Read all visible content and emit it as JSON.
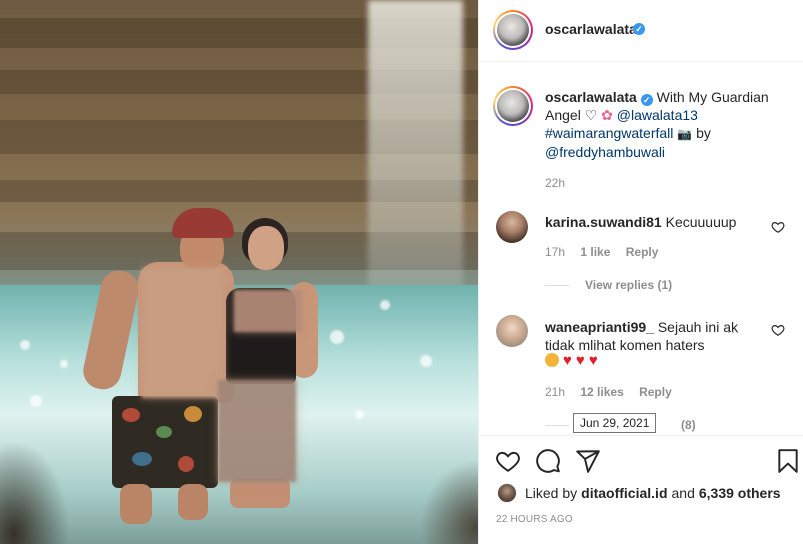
{
  "post": {
    "username": "oscarlawalata",
    "verified_mark": "✓"
  },
  "caption": {
    "username": "oscarlawalata",
    "text_1": "With My Guardian Angel",
    "mention_1": "@lawalata13",
    "hashtag": "#waimarangwaterfall",
    "by_text": "by",
    "mention_2": "@freddyhambuwali",
    "time": "22h"
  },
  "comments": [
    {
      "username": "karina.suwandi81",
      "text": "Kecuuuuup",
      "time": "17h",
      "likes": "1 like",
      "reply": "Reply",
      "view_replies": "View replies (1)"
    },
    {
      "username": "waneaprianti99_",
      "text": "Sejauh ini ak tidak mlihat komen haters",
      "more": "...",
      "time": "21h",
      "likes": "12 likes",
      "reply": "Reply",
      "view_replies_count": "(8)"
    }
  ],
  "tooltip": {
    "date": "Jun 29, 2021"
  },
  "likes": {
    "prefix": "Liked by",
    "user": "ditaofficial.id",
    "connector": "and",
    "others": "6,339 others"
  },
  "timestamp": "22 HOURS AGO",
  "colors": {
    "verified": "#3897f0",
    "link": "#00376b",
    "muted": "#8e8e8e",
    "heart_red": "#e0212d"
  },
  "icons": [
    "heart-icon",
    "comment-icon",
    "share-icon",
    "bookmark-icon",
    "camera-emoji",
    "flower-emoji",
    "white-heart-emoji",
    "clap-emoji"
  ]
}
